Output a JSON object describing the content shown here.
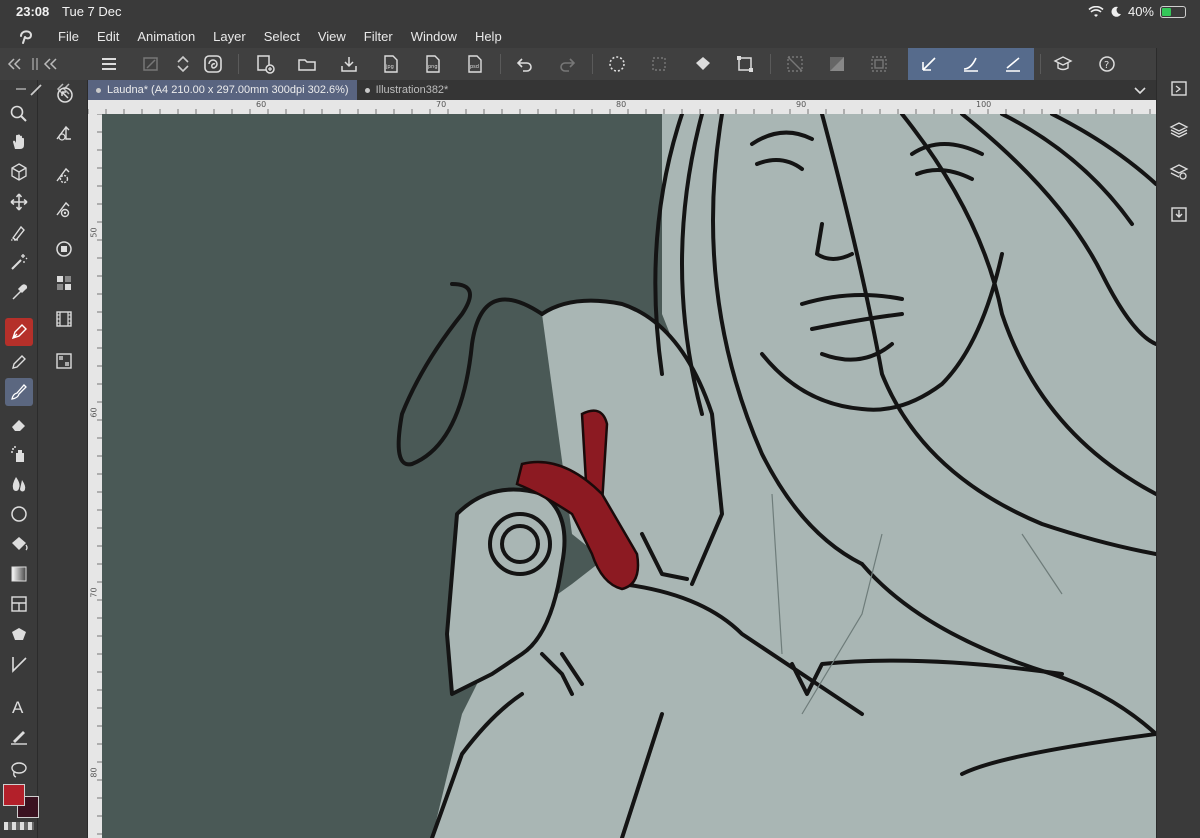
{
  "status_bar": {
    "time": "23:08",
    "date": "Tue 7 Dec",
    "battery": "40%"
  },
  "menu": {
    "items": [
      "File",
      "Edit",
      "Animation",
      "Layer",
      "Select",
      "View",
      "Filter",
      "Window",
      "Help"
    ]
  },
  "tabs": [
    {
      "label": "Laudna* (A4 210.00 x 297.00mm 300dpi 302.6%)",
      "active": true
    },
    {
      "label": "Illustration382*",
      "active": false
    }
  ],
  "ruler": {
    "top_labels": [
      "60",
      "70",
      "80",
      "90",
      "100"
    ],
    "left_labels": [
      "50",
      "60",
      "70",
      "80"
    ]
  },
  "colors": {
    "main_color": "#b3202a",
    "sub_color": "#3a1220",
    "canvas_bg": "#4a5956",
    "skin": "#a9b6b4",
    "ribbon": "#8c1a22",
    "active_tab": "#596480"
  }
}
